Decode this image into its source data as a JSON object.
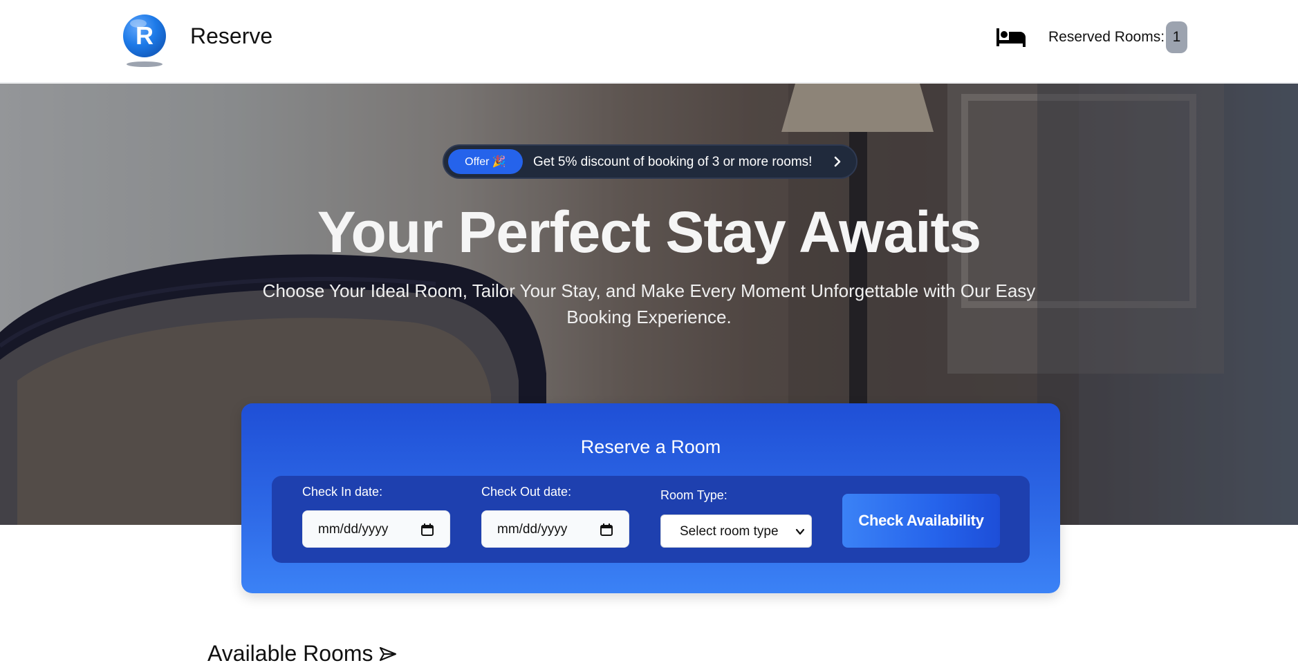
{
  "header": {
    "brand": "Reserve",
    "logo_letter": "R",
    "reserved_label": "Reserved Rooms:",
    "reserved_count": "1",
    "icons": {
      "logo": "brand-r-logo",
      "bed": "bed-icon"
    }
  },
  "hero": {
    "offer_badge": "Offer 🎉",
    "offer_text": "Get 5% discount of booking of 3 or more rooms!",
    "title": "Your Perfect Stay Awaits",
    "subtitle": "Choose Your Ideal Room, Tailor Your Stay, and Make Every Moment Unforgettable with Our Easy Booking Experience."
  },
  "reserve": {
    "title": "Reserve a Room",
    "checkin_label": "Check In date:",
    "checkin_placeholder": "mm/dd/yyyy",
    "checkout_label": "Check Out date:",
    "checkout_placeholder": "mm/dd/yyyy",
    "room_type_label": "Room Type:",
    "room_type_value": "Select room type",
    "button": "Check Availability"
  },
  "rooms": {
    "title": "Available Rooms"
  },
  "colors": {
    "accent": "#2563eb",
    "panel": "#1e40af",
    "badge": "#9ca3af"
  }
}
